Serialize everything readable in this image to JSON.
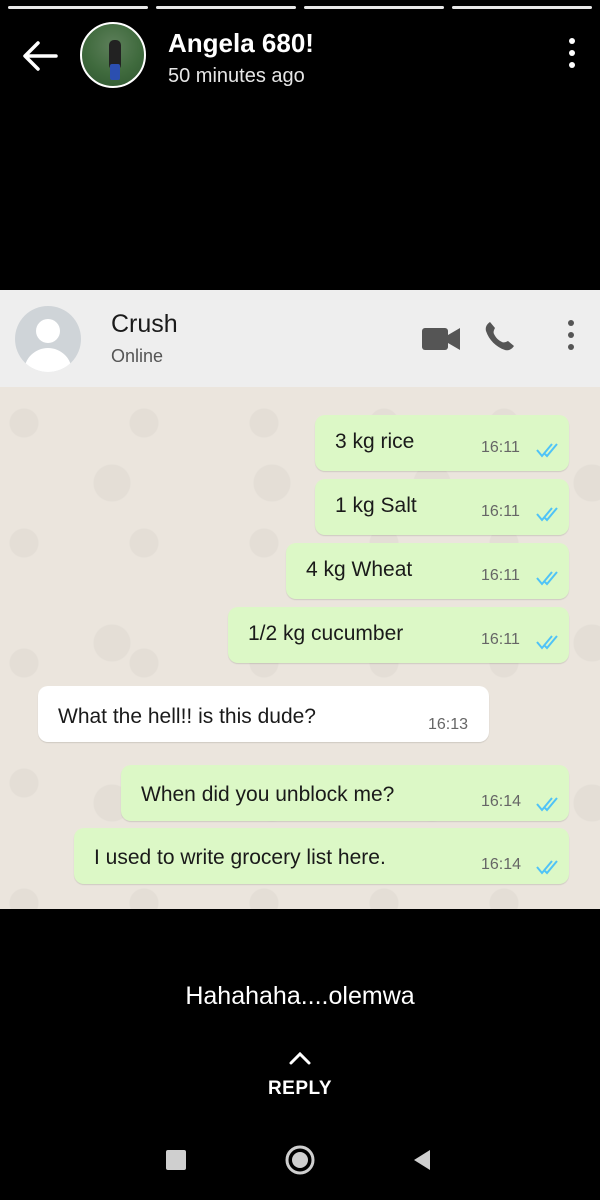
{
  "story": {
    "name": "Angela 680!",
    "time": "50 minutes ago"
  },
  "chat": {
    "contact_name": "Crush",
    "status": "Online",
    "messages": [
      {
        "dir": "out",
        "text": "3 kg rice",
        "time": "16:11"
      },
      {
        "dir": "out",
        "text": "1 kg Salt",
        "time": "16:11"
      },
      {
        "dir": "out",
        "text": "4 kg Wheat",
        "time": "16:11"
      },
      {
        "dir": "out",
        "text": "1/2 kg cucumber",
        "time": "16:11"
      },
      {
        "dir": "in",
        "text": "What the hell!! is this dude?",
        "time": "16:13"
      },
      {
        "dir": "out",
        "text": "When did you unblock me?",
        "time": "16:14"
      },
      {
        "dir": "out",
        "text": "I used to write grocery list here.",
        "time": "16:14"
      }
    ]
  },
  "caption": "Hahahaha....olemwa",
  "reply_label": "REPLY",
  "colors": {
    "outgoing_bubble": "#dcf8c6",
    "incoming_bubble": "#ffffff",
    "read_ticks": "#4fc3f7",
    "chat_background": "#ebe5dd"
  },
  "icons": [
    "back-arrow-icon",
    "more-vertical-icon",
    "video-call-icon",
    "phone-icon",
    "chevron-up-icon",
    "recents-icon",
    "home-icon",
    "back-triangle-icon"
  ]
}
